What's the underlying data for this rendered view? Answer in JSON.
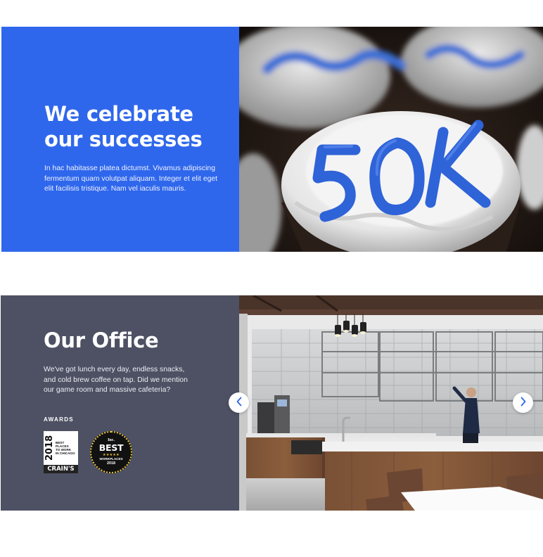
{
  "celebrate": {
    "heading_line1": "We celebrate",
    "heading_line2": "our successes",
    "body": "In hac habitasse platea dictumst. Vivamus adipiscing fermentum quam volutpat aliquam. Integer et elit eget elit facilisis tristique. Nam vel iaculis mauris.",
    "image_icon": "cupcakes-photo",
    "panel_color": "#2f67ec"
  },
  "office": {
    "heading": "Our Office",
    "body": "We've got lunch every day, endless snacks, and cold brew coffee on tap. Did we mention our game room and massive cafeteria?",
    "awards_label": "AWARDS",
    "panel_color": "#4d5163",
    "image_icon": "office-kitchen-photo",
    "awards": {
      "crains": {
        "year": "2018",
        "line1": "BEST",
        "line2": "PLACES",
        "line3": "TO WORK",
        "line4": "IN CHICAGO",
        "brand": "CRAIN'S"
      },
      "inc": {
        "brand": "Inc.",
        "title": "BEST",
        "stars": "★★★★★",
        "subtitle": "WORKPLACES",
        "year": "2018"
      }
    },
    "carousel": {
      "prev_icon": "chevron-left-icon",
      "next_icon": "chevron-right-icon"
    }
  }
}
